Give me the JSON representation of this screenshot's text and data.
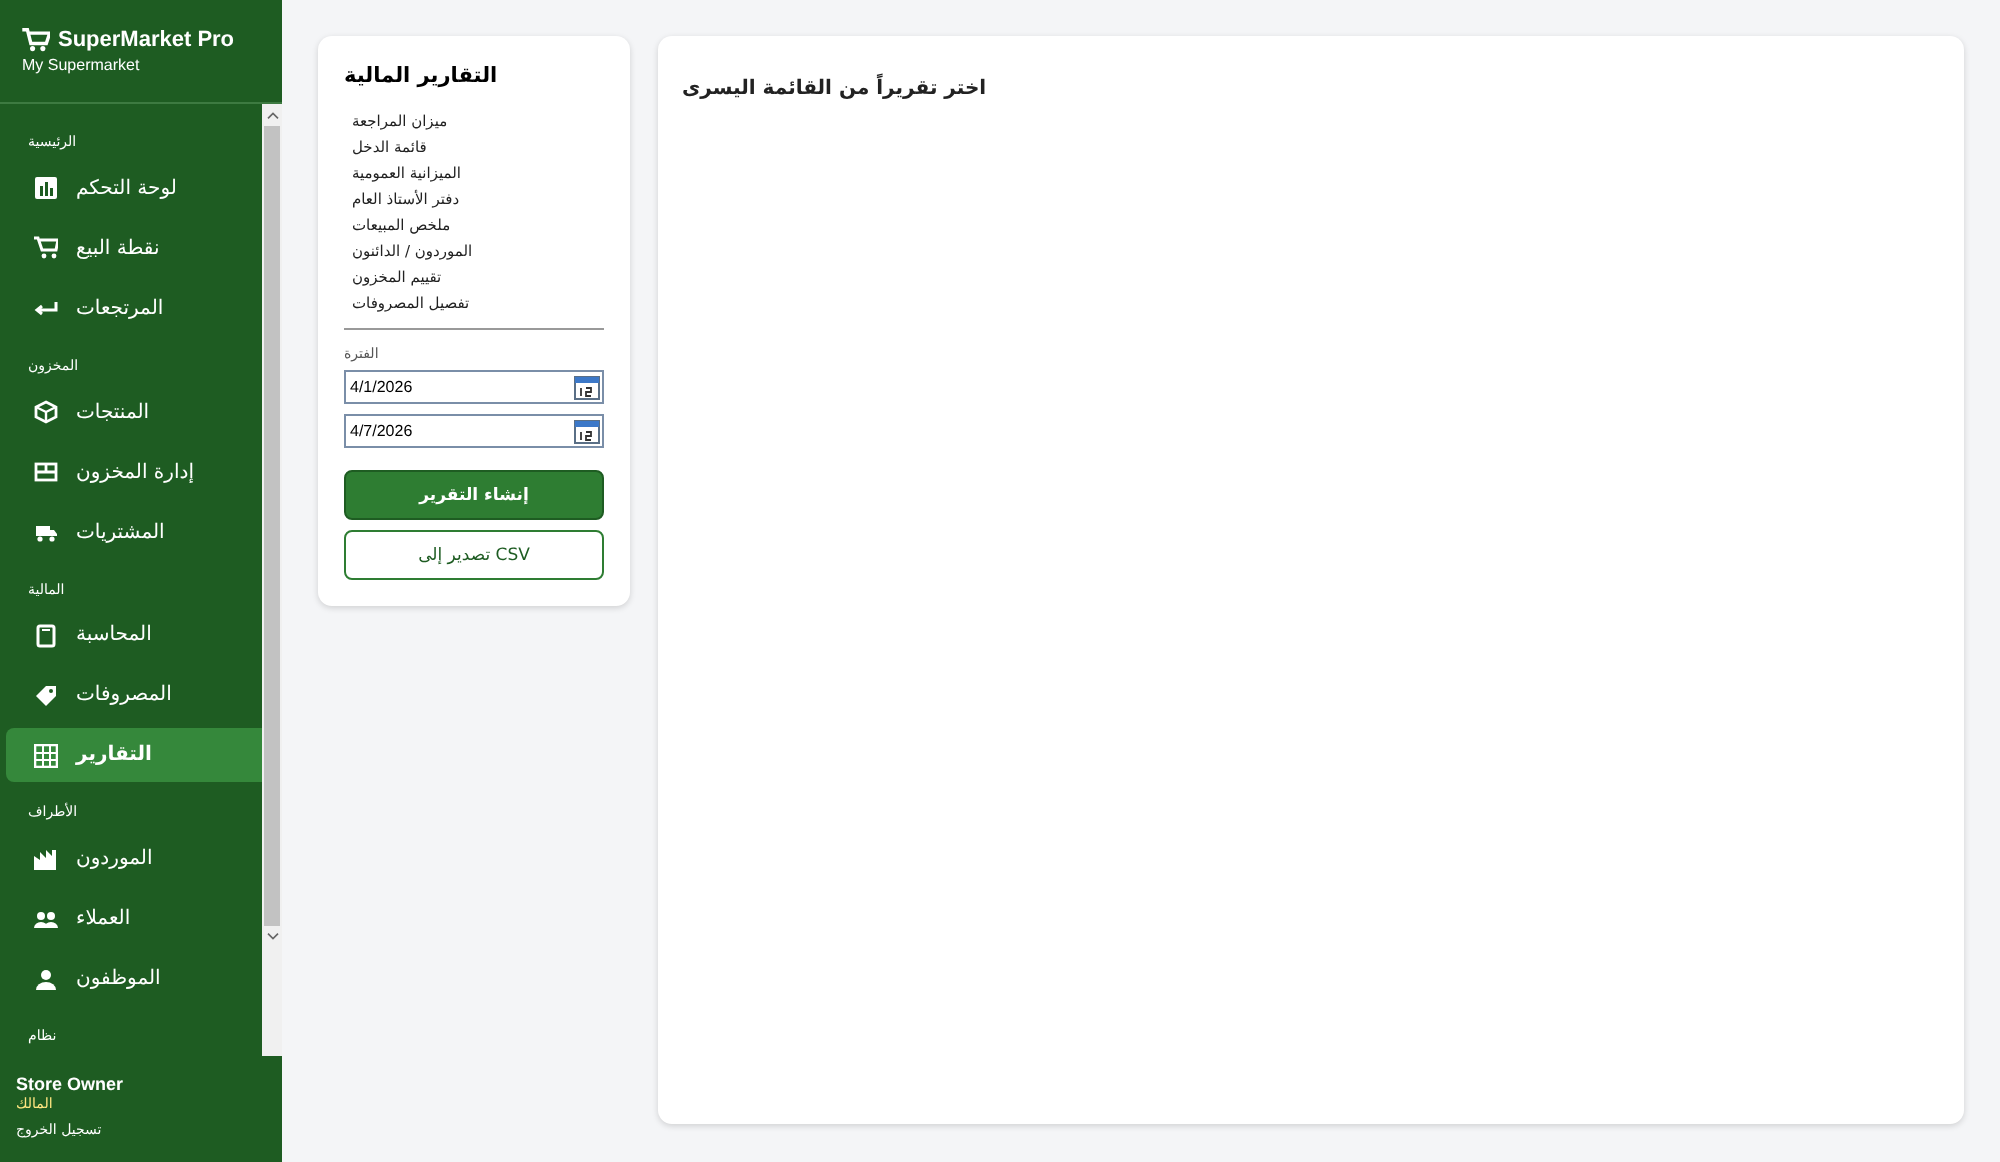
{
  "brand": {
    "name": "SuperMarket Pro",
    "subtitle": "My Supermarket"
  },
  "sections": [
    {
      "title": "الرئيسية",
      "items": [
        {
          "label": "لوحة التحكم",
          "selected": false
        },
        {
          "label": "نقطة البيع",
          "selected": false
        },
        {
          "label": "المرتجعات",
          "selected": false
        }
      ]
    },
    {
      "title": "المخزون",
      "items": [
        {
          "label": "المنتجات",
          "selected": false
        },
        {
          "label": "إدارة المخزون",
          "selected": false
        },
        {
          "label": "المشتريات",
          "selected": false
        }
      ]
    },
    {
      "title": "المالية",
      "items": [
        {
          "label": "المحاسبة",
          "selected": false
        },
        {
          "label": "المصروفات",
          "selected": false
        },
        {
          "label": "التقارير",
          "selected": true
        }
      ]
    },
    {
      "title": "الأطراف",
      "items": [
        {
          "label": "الموردون",
          "selected": false
        },
        {
          "label": "العملاء",
          "selected": false
        },
        {
          "label": "الموظفون",
          "selected": false
        }
      ]
    },
    {
      "title": "نظام"
    }
  ],
  "user": {
    "name": "Store Owner",
    "role": "المالك",
    "logout": "تسجيل الخروج"
  },
  "reports": {
    "title": "التقارير المالية",
    "items": [
      "ميزان المراجعة",
      "قائمة الدخل",
      "الميزانية العمومية",
      "دفتر الأستاذ العام",
      "ملخص المبيعات",
      "الموردون / الدائنون",
      "تقييم المخزون",
      "تفصيل المصروفات"
    ],
    "period_label": "الفترة",
    "date_from": "4/1/2026",
    "date_to": "4/7/2026",
    "generate": "إنشاء التقرير",
    "export": "تصدير إلى CSV"
  },
  "content": {
    "message": "اختر تقريراً من القائمة اليسرى"
  }
}
